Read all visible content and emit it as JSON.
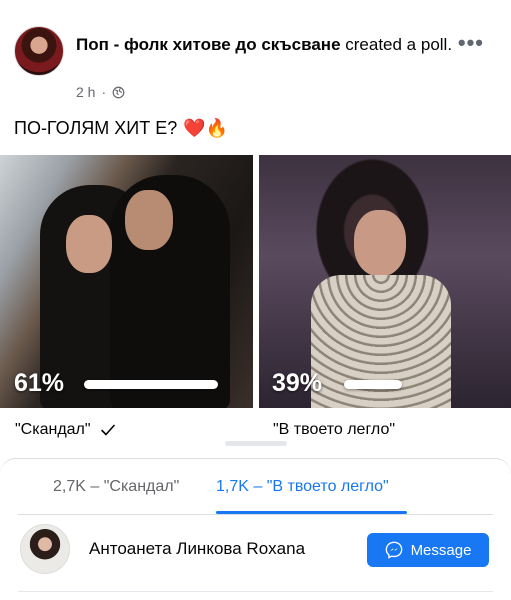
{
  "post": {
    "page_name": "Поп - фолк хитове до скъсване",
    "action_text": " created a poll.",
    "time": "2 h",
    "privacy_icon": "globe-icon",
    "more_icon": "more-horizontal-icon",
    "text": "ПО-ГОЛЯМ ХИТ Е?",
    "emojis": "❤️🔥"
  },
  "poll": {
    "options": [
      {
        "label": "\"Скандал\"",
        "percent_text": "61%",
        "percent": 61,
        "selected": true
      },
      {
        "label": "\"В твоето легло\"",
        "percent_text": "39%",
        "percent": 39,
        "selected": false
      }
    ]
  },
  "sheet": {
    "tabs": [
      {
        "label": "2,7K – \"Скандал\"",
        "active": false
      },
      {
        "label": "1,7K – \"В твоето легло\"",
        "active": true
      }
    ],
    "voter": {
      "name": "Антоанета Линкова Roxana",
      "button_label": "Message"
    }
  },
  "colors": {
    "accent": "#1877f2",
    "secondary_text": "#65676b"
  }
}
